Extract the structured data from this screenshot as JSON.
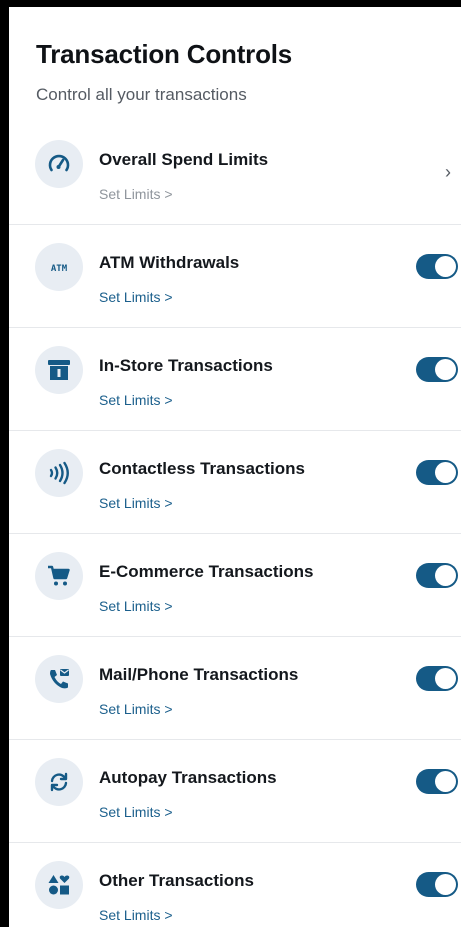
{
  "header": {
    "title": "Transaction Controls",
    "subtitle": "Control all your transactions"
  },
  "colors": {
    "accent": "#155a86",
    "link": "#1b5f8c",
    "icon_bg": "#e8edf3"
  },
  "items": [
    {
      "title": "Overall Spend Limits",
      "link": "Set Limits >",
      "icon": "speedometer-icon",
      "control": "chevron",
      "chevron": "›"
    },
    {
      "title": "ATM Withdrawals",
      "link": "Set Limits >",
      "icon": "atm-icon",
      "icon_text": "ATM",
      "control": "toggle",
      "enabled": true
    },
    {
      "title": "In-Store Transactions",
      "link": "Set Limits >",
      "icon": "store-icon",
      "control": "toggle",
      "enabled": true
    },
    {
      "title": "Contactless Transactions",
      "link": "Set Limits >",
      "icon": "contactless-icon",
      "control": "toggle",
      "enabled": true
    },
    {
      "title": "E-Commerce Transactions",
      "link": "Set Limits >",
      "icon": "cart-icon",
      "control": "toggle",
      "enabled": true
    },
    {
      "title": "Mail/Phone Transactions",
      "link": "Set Limits >",
      "icon": "phone-icon",
      "control": "toggle",
      "enabled": true
    },
    {
      "title": "Autopay Transactions",
      "link": "Set Limits >",
      "icon": "autopay-icon",
      "control": "toggle",
      "enabled": true
    },
    {
      "title": "Other Transactions",
      "link": "Set Limits >",
      "icon": "shapes-icon",
      "control": "toggle",
      "enabled": true
    }
  ]
}
